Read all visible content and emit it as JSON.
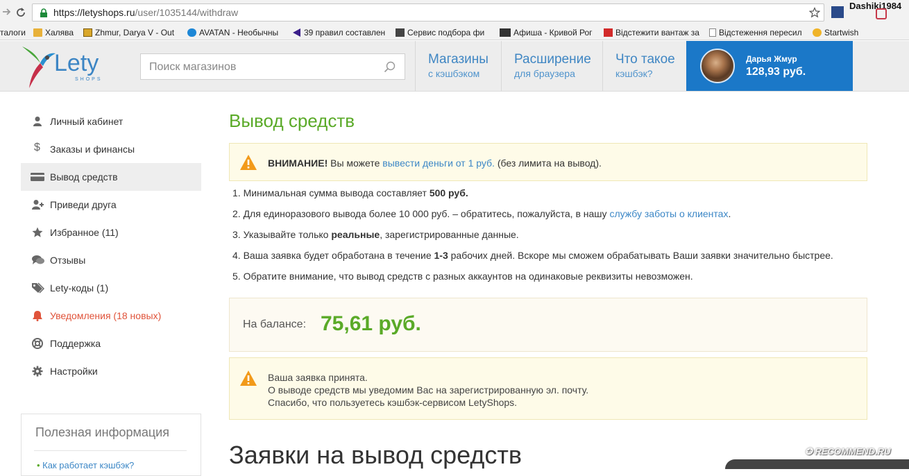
{
  "browser": {
    "url_domain": "https://letyshops.ru",
    "url_path": "/user/1035144/withdraw",
    "profile_name": "Dashiki1984",
    "bookmarks": [
      "талоги",
      "Халява",
      "Zhmur, Darya V - Out",
      "AVATAN - Необычны",
      "39 правил составлен",
      "Сервис подбора фи",
      "Афиша - Кривой Рог",
      "Відстежити вантаж за",
      "Відстеження пересил",
      "Startwish"
    ]
  },
  "header": {
    "logo_text": "Lety",
    "logo_sub": "SHOPS",
    "search_placeholder": "Поиск магазинов",
    "nav": [
      {
        "big": "Магазины",
        "small": "с кэшбэком"
      },
      {
        "big": "Расширение",
        "small": "для браузера"
      },
      {
        "big": "Что такое",
        "small": "кэшбэк?"
      }
    ],
    "user": {
      "name": "Дарья Жмур",
      "balance": "128,93 руб."
    }
  },
  "sidebar": {
    "items": [
      {
        "label": "Личный кабинет"
      },
      {
        "label": "Заказы и финансы"
      },
      {
        "label": "Вывод средств"
      },
      {
        "label": "Приведи друга"
      },
      {
        "label": "Избранное (11)"
      },
      {
        "label": "Отзывы"
      },
      {
        "label": "Lety-коды (1)"
      },
      {
        "label": "Уведомления (18 новых)"
      },
      {
        "label": "Поддержка"
      },
      {
        "label": "Настройки"
      }
    ],
    "info_title": "Полезная информация",
    "info_link": "Как работает кэшбэк?"
  },
  "main": {
    "title": "Вывод средств",
    "alert": {
      "bold": "ВНИМАНИЕ!",
      "pre": " Вы можете ",
      "link": "вывести деньги от 1 руб.",
      "post": " (без лимита на вывод)."
    },
    "rules": {
      "r1_pre": "1. Минимальная сумма вывода составляет ",
      "r1_bold": "500 руб.",
      "r2_pre": "2. Для единоразового вывода более 10 000 руб. – обратитесь, пожалуйста, в нашу ",
      "r2_link": "службу заботы о клиентах",
      "r2_post": ".",
      "r3_pre": "3. Указывайте только ",
      "r3_bold": "реальные",
      "r3_post": ", зарегистрированные данные.",
      "r4_pre": "4. Ваша заявка будет обработана в течение ",
      "r4_bold": "1-3",
      "r4_post": " рабочих дней. Вскоре мы сможем обрабатывать Ваши заявки значительно быстрее.",
      "r5": "5. Обратите внимание, что вывод средств с разных аккаунтов на одинаковые реквизиты невозможен."
    },
    "balance_label": "На балансе:",
    "balance_value": "75,61 руб.",
    "notice": {
      "line1": "Ваша заявка принята.",
      "line2": "О выводе средств мы уведомим Вас на зарегистрированную эл. почту.",
      "line3": "Спасибо, что пользуетесь кэшбэк-сервисом LetyShops."
    },
    "requests_title": "Заявки на вывод средств"
  },
  "watermark": "RECOMMEND.RU",
  "colors": {
    "accent_green": "#5aaa28",
    "link_blue": "#3c87c6",
    "user_blue": "#1b78c8",
    "alert_orange": "#f29a1a",
    "notify_red": "#e0533a"
  }
}
